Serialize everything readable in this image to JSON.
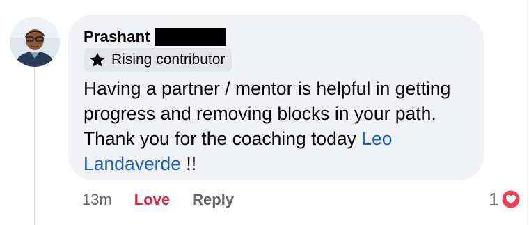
{
  "comment": {
    "author_name": "Prashant",
    "badge_label": "Rising contributor",
    "badge_icon": "star-icon",
    "text_main": "Having a partner / mentor is helpful in getting progress and removing blocks in your path. Thank you for the coaching today ",
    "mention": "Leo Landaverde",
    "text_end": " !!",
    "timestamp": "13m",
    "love_label": "Love",
    "reply_label": "Reply",
    "reaction_count": "1",
    "reaction_icon": "heart-icon"
  },
  "colors": {
    "bubble_bg": "#f0f2f5",
    "mention": "#1a5fc8",
    "love": "#e0243c",
    "heart_fill": "#f33e58"
  }
}
